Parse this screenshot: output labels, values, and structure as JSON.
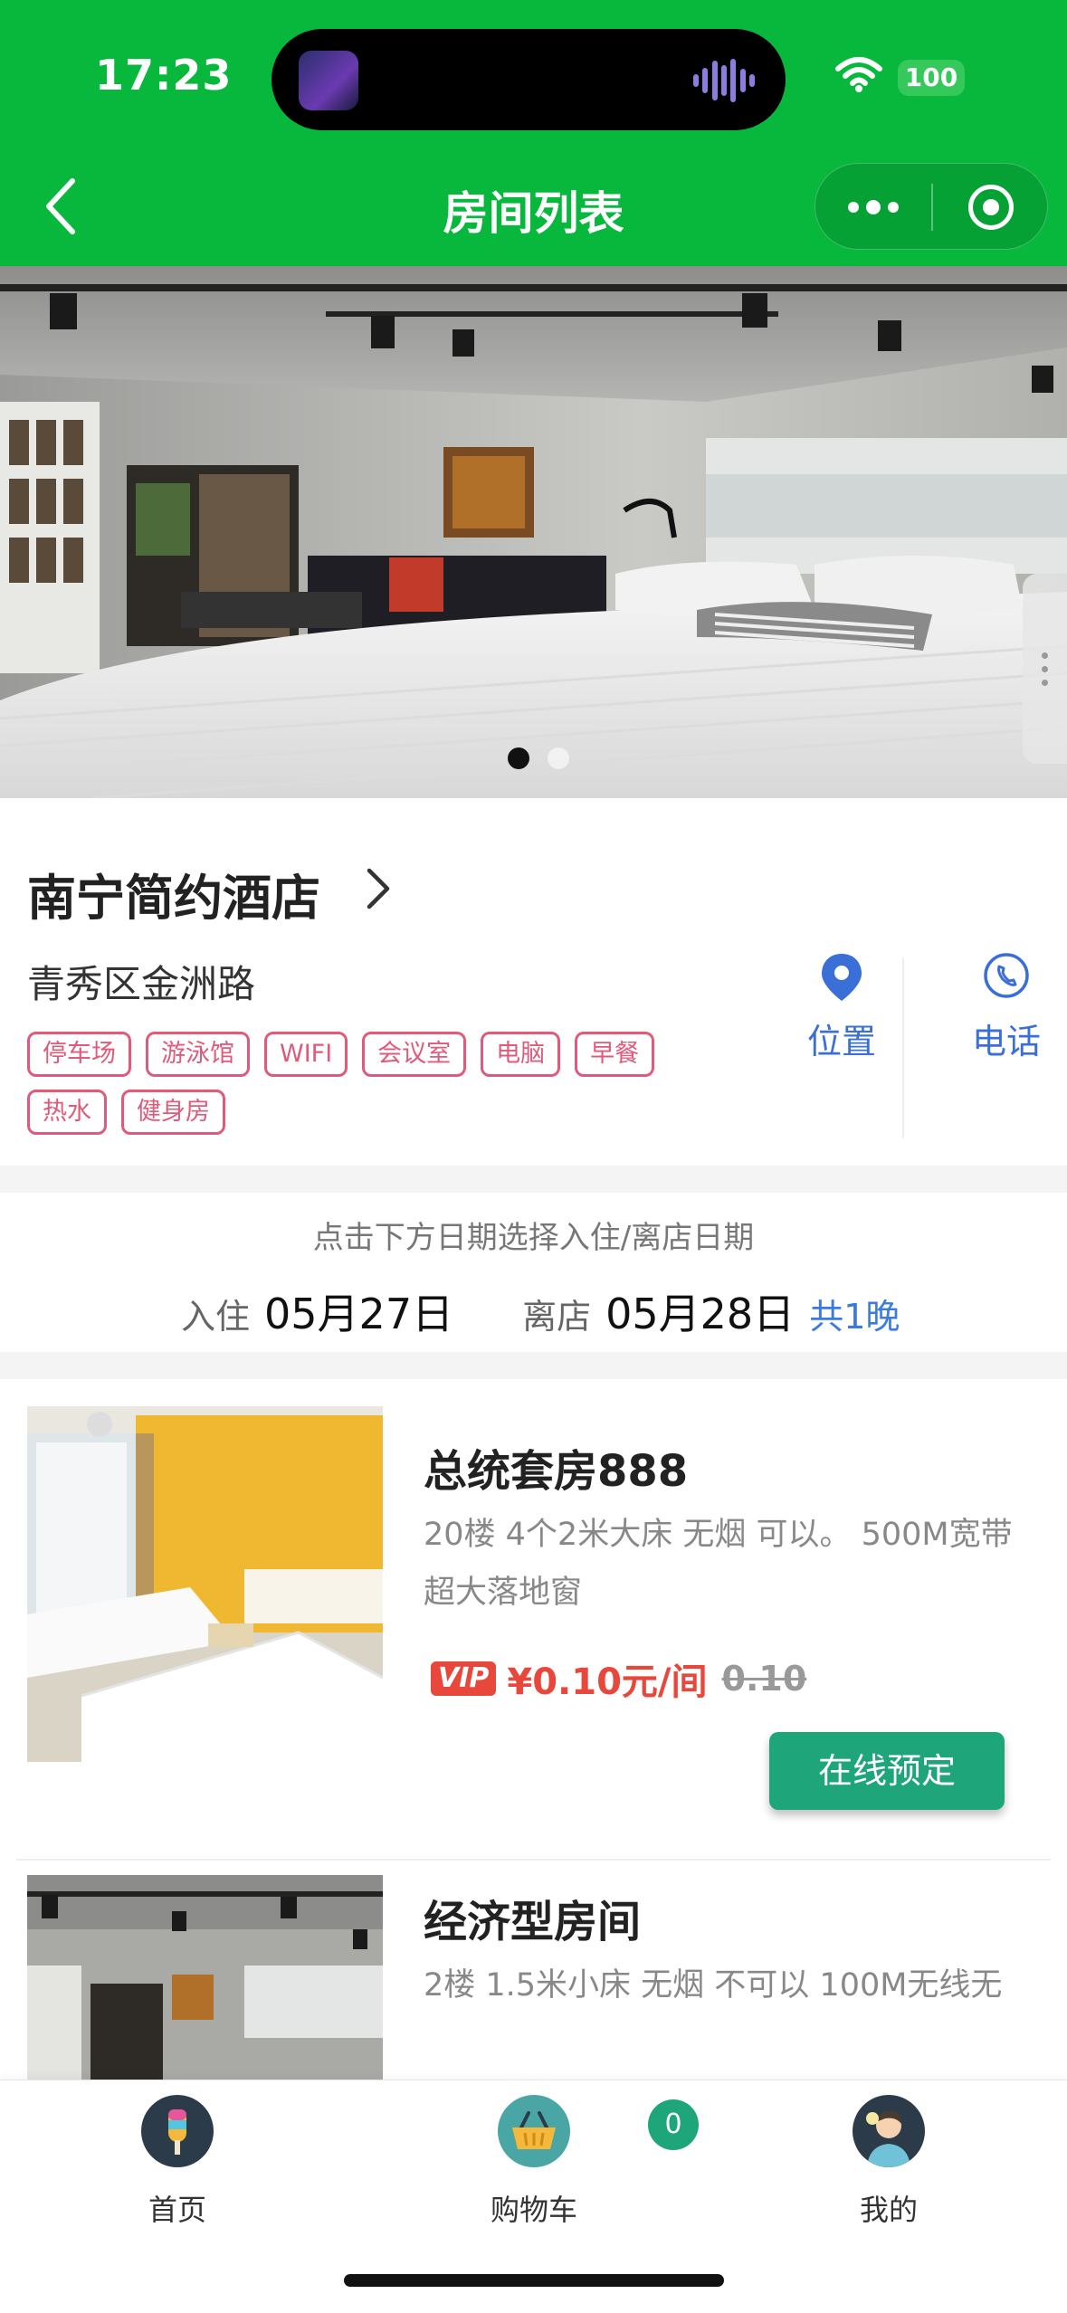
{
  "status_bar": {
    "time": "17:23",
    "battery": "100"
  },
  "nav": {
    "title": "房间列表"
  },
  "banner": {
    "slide_count": 2,
    "active_index": 0
  },
  "hotel": {
    "name": "南宁简约酒店",
    "address": "青秀区金洲路",
    "tags": [
      "停车场",
      "游泳馆",
      "WIFI",
      "会议室",
      "电脑",
      "早餐",
      "热水",
      "健身房"
    ],
    "location_label": "位置",
    "phone_label": "电话"
  },
  "dates": {
    "hint": "点击下方日期选择入住/离店日期",
    "checkin_label": "入住",
    "checkin_value": "05月27日",
    "checkout_label": "离店",
    "checkout_value": "05月28日",
    "nights": "共1晚"
  },
  "rooms": [
    {
      "name": "总统套房888",
      "desc": "20楼  4个2米大床  无烟  可以。 500M宽带  超大落地窗",
      "vip_label": "VIP",
      "price": "¥0.10元/间",
      "original_price": "0.10",
      "book_label": "在线预定"
    },
    {
      "name": "经济型房间",
      "desc": "2楼  1.5米小床  无烟  不可以  100M无线无"
    }
  ],
  "tabbar": {
    "items": [
      {
        "label": "首页"
      },
      {
        "label": "购物车"
      },
      {
        "label": "我的"
      }
    ],
    "cart_count": "0"
  },
  "colors": {
    "header_green": "#07b83c",
    "accent_blue": "#3a6fd8",
    "tag_pink": "#e05a7a",
    "price_red": "#e8473b",
    "book_green": "#1fa57a"
  }
}
